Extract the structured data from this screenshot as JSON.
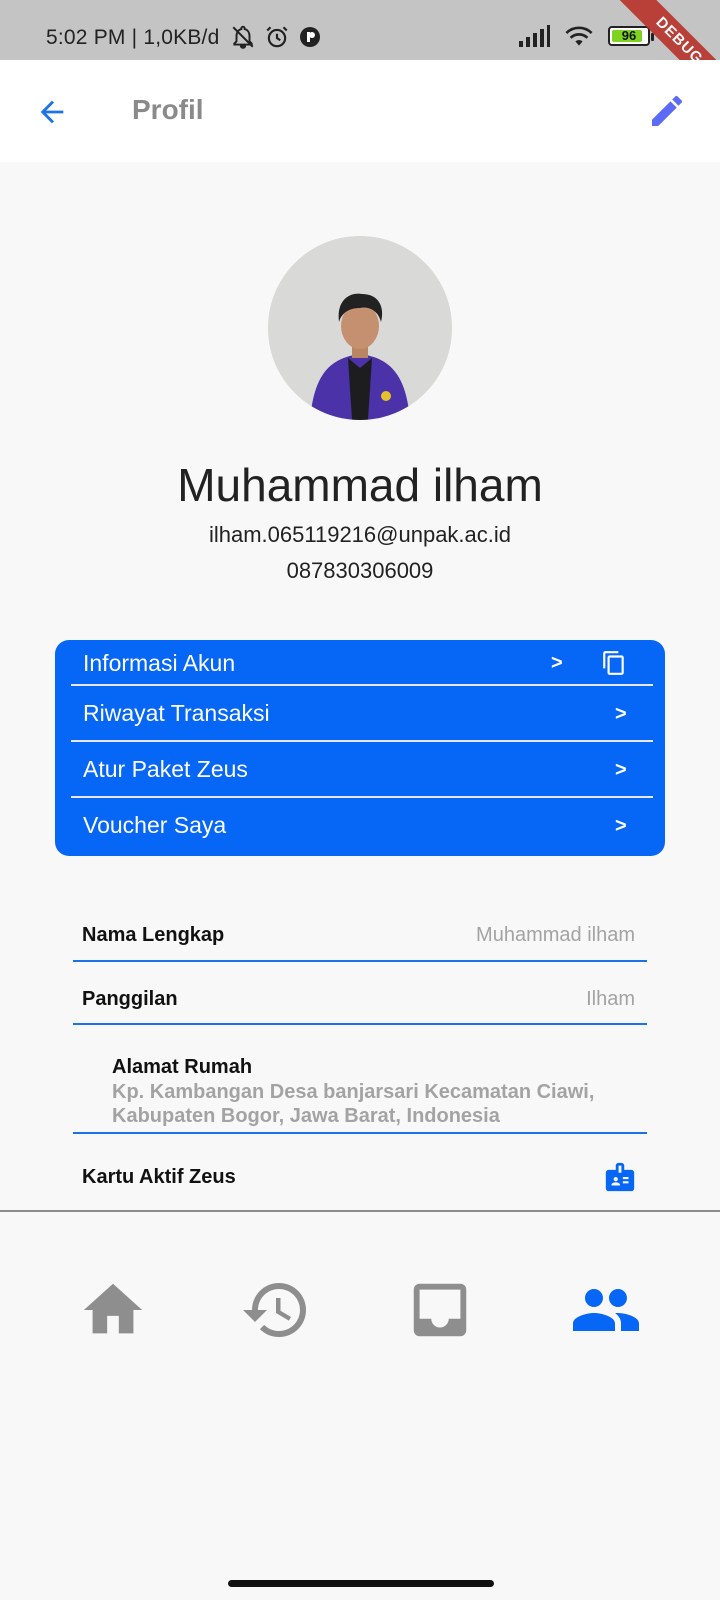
{
  "status_bar": {
    "time_text": "5:02 PM | 1,0KB/d",
    "battery_level": "96",
    "debug_label": "DEBUG"
  },
  "app_bar": {
    "title": "Profil",
    "back_icon": "arrow-back-icon",
    "edit_icon": "pencil-icon"
  },
  "profile": {
    "name": "Muhammad ilham",
    "email": "ilham.065119216@unpak.ac.id",
    "phone": "087830306009"
  },
  "menu": {
    "color": "#0666f6",
    "items": [
      {
        "label": "Informasi Akun",
        "arrow": ">"
      },
      {
        "label": "Riwayat Transaksi",
        "arrow": ">"
      },
      {
        "label": "Atur Paket Zeus",
        "arrow": ">"
      },
      {
        "label": "Voucher Saya",
        "arrow": ">"
      }
    ]
  },
  "info": {
    "full_name": {
      "label": "Nama Lengkap",
      "value": "Muhammad ilham"
    },
    "nickname": {
      "label": "Panggilan",
      "value": "Ilham"
    },
    "address": {
      "label": "Alamat Rumah",
      "value": "Kp. Kambangan Desa banjarsari Kecamatan Ciawi, Kabupaten Bogor, Jawa Barat, Indonesia"
    },
    "active_card": {
      "label": "Kartu Aktif Zeus"
    }
  },
  "bottom_nav": {
    "items": [
      "home-icon",
      "history-icon",
      "inbox-icon",
      "people-icon"
    ],
    "active_index": 3,
    "active_color": "#0666f6",
    "inactive_color": "#8e8e8e"
  }
}
